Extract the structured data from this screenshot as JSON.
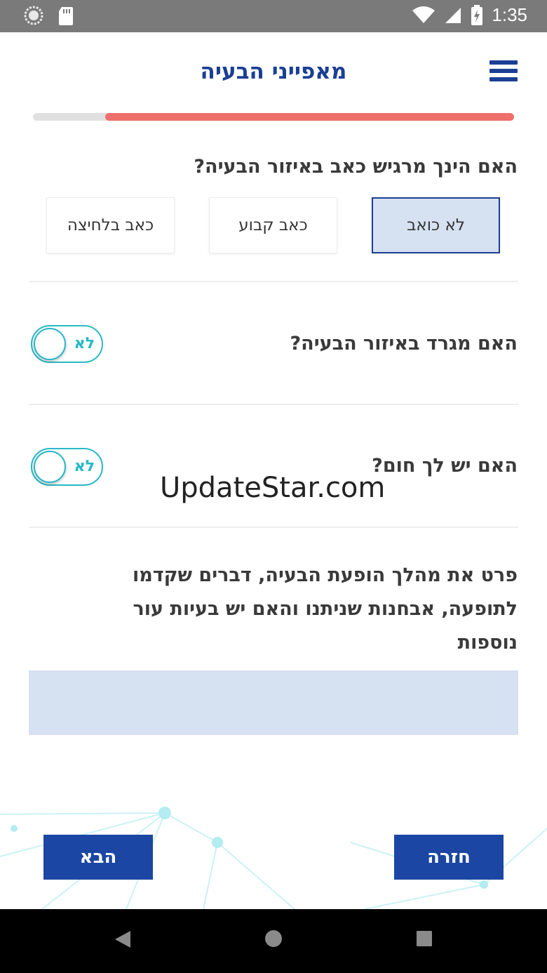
{
  "status_bar": {
    "time": "1:35",
    "left_icons": [
      "sync-icon",
      "sd-card-icon"
    ],
    "right_icons": [
      "wifi-icon",
      "signal-icon",
      "battery-icon"
    ]
  },
  "header": {
    "title": "מאפייני הבעיה",
    "menu_icon": "hamburger-menu-icon"
  },
  "progress": {
    "value": 0.85
  },
  "pain_question": {
    "text": "האם הינך מרגיש כאב באיזור הבעיה?",
    "options": [
      "לא כואב",
      "כאב קבוע",
      "כאב בלחיצה"
    ],
    "selected": "לא כואב"
  },
  "itch_question": {
    "text": "האם מגרד באיזור הבעיה?",
    "toggle_label": "לא"
  },
  "fever_question": {
    "text": "האם יש לך חום?",
    "toggle_label": "לא"
  },
  "watermark": "UpdateStar.com",
  "description_question": {
    "text": "פרט את מהלך הופעת הבעיה, דברים שקדמו לתופעה, אבחנות שניתנו והאם יש בעיות עור נוספות",
    "value": ""
  },
  "buttons": {
    "back": "חזרה",
    "next": "הבא"
  },
  "colors": {
    "brand": "#1b3f94",
    "progress": "#ef6f6c",
    "toggle": "#29b8c8",
    "selected_bg": "#d6e1f1"
  }
}
